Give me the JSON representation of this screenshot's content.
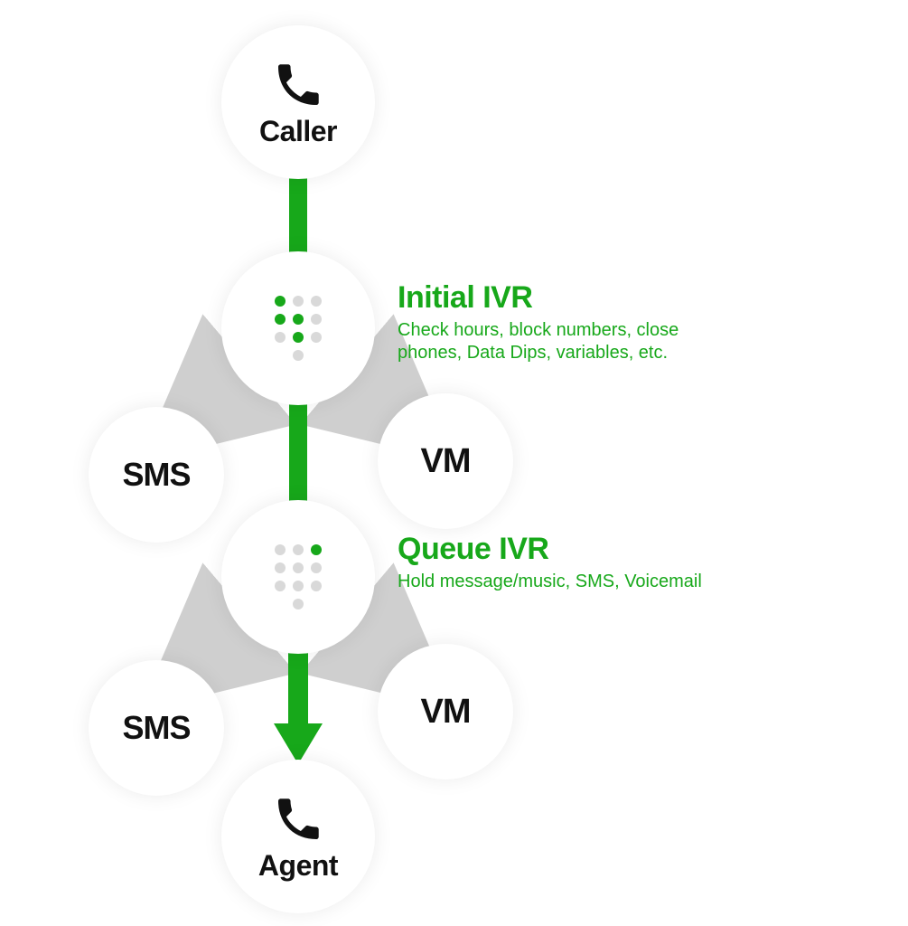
{
  "colors": {
    "green": "#17a81a",
    "gray": "#cfcfcf",
    "text": "#111111"
  },
  "nodes": {
    "caller": {
      "label": "Caller"
    },
    "ivr1": {},
    "ivr2": {},
    "sms1": {
      "label": "SMS"
    },
    "vm1": {
      "label": "VM"
    },
    "sms2": {
      "label": "SMS"
    },
    "vm2": {
      "label": "VM"
    },
    "agent": {
      "label": "Agent"
    }
  },
  "annotations": {
    "initial_ivr": {
      "title": "Initial IVR",
      "desc": "Check hours, block numbers, close phones, Data Dips, variables, etc."
    },
    "queue_ivr": {
      "title": "Queue IVR",
      "desc": "Hold message/music, SMS, Voicemail"
    }
  }
}
